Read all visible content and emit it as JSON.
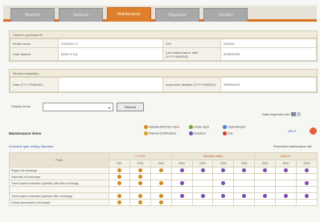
{
  "tabs": [
    {
      "label": "Machine",
      "active": false
    },
    {
      "label": "Services",
      "active": false
    },
    {
      "label": "Maintenance",
      "active": true
    },
    {
      "label": "Diagnosis",
      "active": false
    },
    {
      "label": "Contact",
      "active": false
    }
  ],
  "owner_section": {
    "header": "Owner's purchase ID",
    "rows": [
      {
        "l1": "Model name",
        "v1": "ZX200LC-3",
        "l2": "S/N",
        "v2": "010010"
      },
      {
        "l1": "Date started",
        "v1": "(2011.9.14)",
        "l2": "Last maintenance date (YYYY/MM/DD)",
        "v2": "2008/10/09"
      }
    ]
  },
  "service_section": {
    "header": "Service inspection",
    "rows": [
      {
        "l1": "Date (YYYY/MM/DD)",
        "v1": "",
        "l2": "Inspection detailed (YYYY/MM/DD)",
        "v2": "2009/04/23"
      }
    ]
  },
  "display": {
    "label": "Display items",
    "select_value": "",
    "refresh_label": "Refresh",
    "side_link": "Daily inspection list"
  },
  "maintenance": {
    "title": "Maintenance items",
    "help_label": "HELP",
    "schedule_link": "Schedule type setting Standard",
    "periodic_link": "Periodical maintenance list",
    "legend": [
      {
        "label": "Standard/ROUGH input",
        "color": "#d4891f"
      },
      {
        "label": "Grade input",
        "color": "#6cab2e"
      },
      {
        "label": "Optional input",
        "color": "#4b7fc7"
      },
      {
        "label": "Planned (notification)",
        "color": "#d9a11c"
      },
      {
        "label": "Required",
        "color": "#7d4bb0"
      },
      {
        "label": "Due",
        "color": "#d53a2a"
      }
    ],
    "hours_header_1": "<< Prev",
    "hours_header_2": "Standard value",
    "hours_header_3": "Next >>",
    "parts_header": "Parts",
    "hours": [
      "500",
      "1000",
      "1500",
      "2000",
      "2500",
      "3000",
      "3500",
      "4000",
      "4500",
      "5000"
    ],
    "rows": [
      {
        "name": "Engine oil exchange",
        "marks": [
          "orange",
          "orange",
          "orange",
          "purple",
          "purple",
          "purple",
          "purple",
          "purple",
          "purple",
          "purple"
        ]
      },
      {
        "name": "Hydraulic oil exchange",
        "marks": [
          "orange",
          "orange",
          "",
          "",
          "",
          "",
          "",
          "",
          "",
          ""
        ]
      },
      {
        "name": "Travel speed reduction hydraulic pilot filter exchange",
        "marks": [
          "orange",
          "orange",
          "orange",
          "purple",
          "",
          "purple",
          "",
          "",
          "",
          "purple"
        ]
      },
      {
        "name": "",
        "marks": [
          "",
          "",
          "",
          "",
          "",
          "",
          "",
          "",
          "",
          ""
        ]
      },
      {
        "name": "Travel speed reduction hydraulic filter exchange",
        "marks": [
          "orange",
          "orange",
          "orange",
          "purple",
          "purple",
          "purple",
          "purple",
          "purple",
          "purple",
          "purple"
        ]
      },
      {
        "name": "Swing transmission oil change",
        "marks": [
          "orange",
          "orange",
          "orange",
          "",
          "",
          "",
          "",
          "",
          "",
          ""
        ]
      }
    ]
  }
}
